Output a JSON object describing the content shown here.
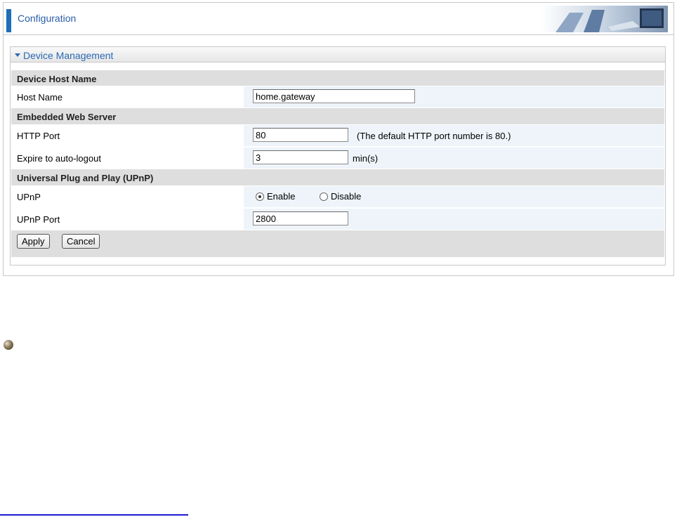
{
  "header": {
    "title": "Configuration"
  },
  "panel": {
    "title": "Device Management"
  },
  "sections": {
    "host": "Device Host Name",
    "web": "Embedded Web Server",
    "upnp": "Universal Plug and Play (UPnP)"
  },
  "fields": {
    "host_name": {
      "label": "Host Name",
      "value": "home.gateway"
    },
    "http_port": {
      "label": "HTTP Port",
      "value": "80",
      "hint": "(The default HTTP port number is 80.)"
    },
    "auto_logout": {
      "label": "Expire to auto-logout",
      "value": "3",
      "unit": "min(s)"
    },
    "upnp": {
      "label": "UPnP",
      "enable_label": "Enable",
      "disable_label": "Disable",
      "selected": "Enable"
    },
    "upnp_port": {
      "label": "UPnP Port",
      "value": "2800"
    }
  },
  "buttons": {
    "apply": "Apply",
    "cancel": "Cancel"
  },
  "colors": {
    "accent": "#1d6fb8",
    "title": "#2a6ab3",
    "section_bg": "#dedede",
    "field_bg": "#eef4fa"
  }
}
